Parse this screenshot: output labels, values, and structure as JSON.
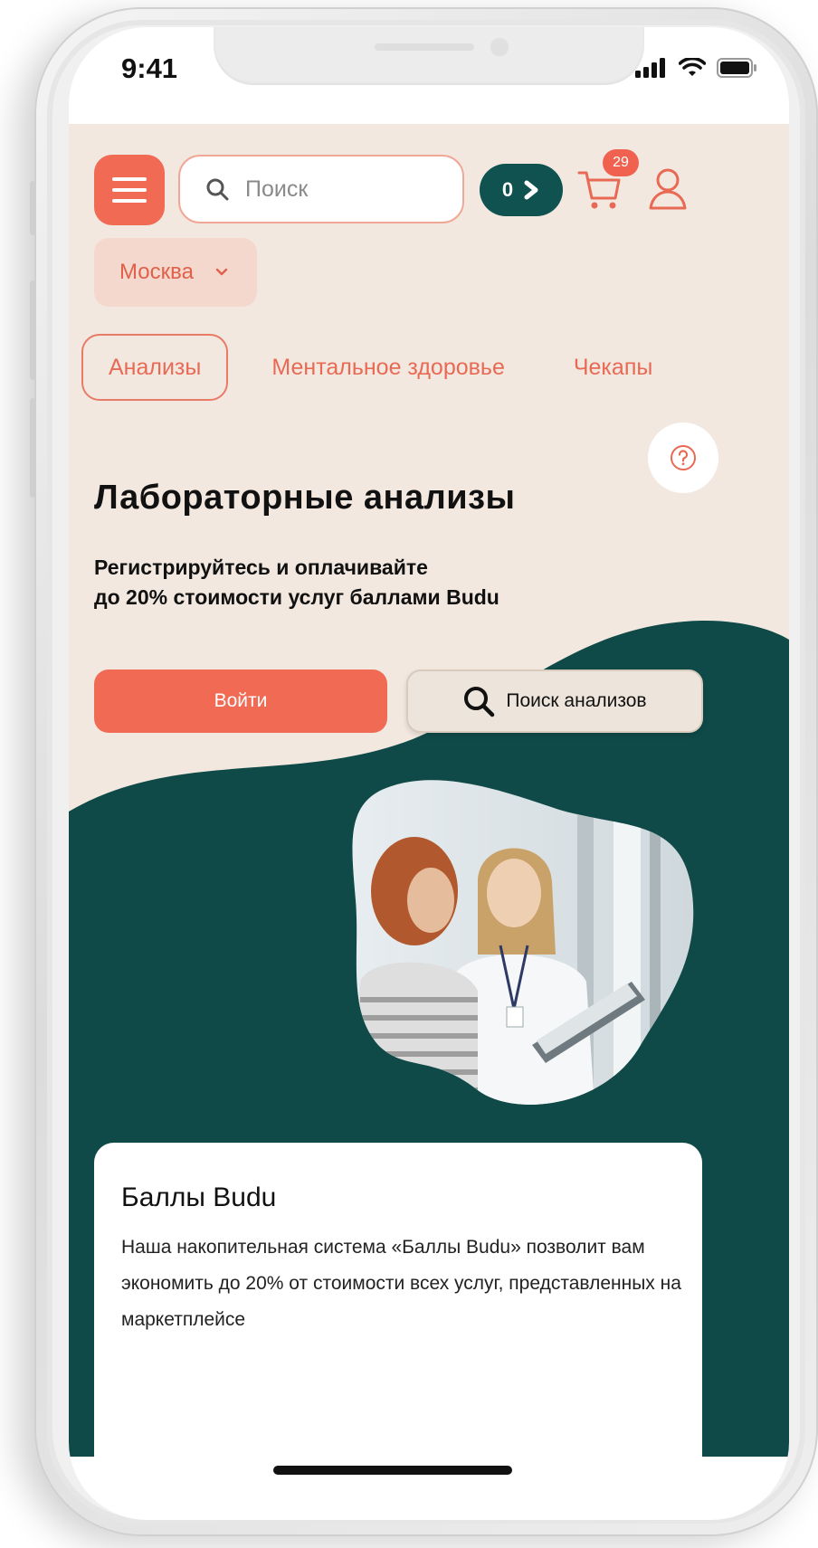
{
  "status_bar": {
    "time": "9:41"
  },
  "header": {
    "search_placeholder": "Поиск",
    "points_count": "0",
    "cart_badge": "29"
  },
  "city": {
    "label": "Москва"
  },
  "tabs": [
    {
      "label": "Анализы",
      "active": true
    },
    {
      "label": "Ментальное здоровье",
      "active": false
    },
    {
      "label": "Чекапы",
      "active": false
    }
  ],
  "hero": {
    "title": "Лабораторные анализы",
    "promo_line1": "Регистрируйтесь и оплачивайте",
    "promo_line2": "до 20% стоимости услуг баллами Budu",
    "login_label": "Войти",
    "search_label": "Поиск анализов"
  },
  "card": {
    "title": "Баллы Budu",
    "text": "Наша накопительная система «Баллы Budu» позволит вам экономить до 20% от стоимости всех услуг, представленных на маркетплейсе"
  },
  "colors": {
    "accent": "#f06a54",
    "background": "#f2e8e0",
    "teal": "#0f4a48",
    "points_pill": "#0f5250"
  }
}
